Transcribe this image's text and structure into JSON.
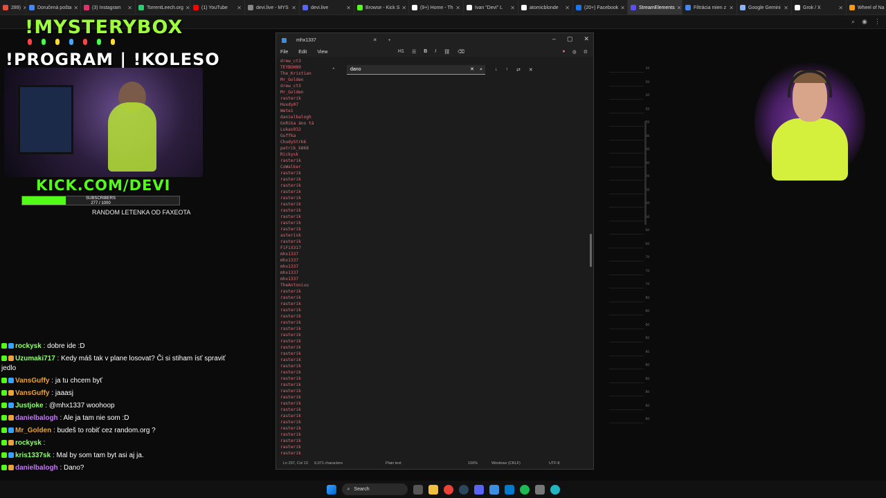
{
  "browser": {
    "tabs": [
      {
        "label": "289)",
        "color": "#e74c3c"
      },
      {
        "label": "Doručená pošta",
        "color": "#4285f4"
      },
      {
        "label": "(3) Instagram",
        "color": "#e1306c"
      },
      {
        "label": "TorrentLeech.org",
        "color": "#2ecc71"
      },
      {
        "label": "(1) YouTube",
        "color": "#ff0000"
      },
      {
        "label": "devi.live - MYS",
        "color": "#888888"
      },
      {
        "label": "devi.live",
        "color": "#5865f2"
      },
      {
        "label": "Browse - Kick S",
        "color": "#53fc18"
      },
      {
        "label": "(9+) Home - Th",
        "color": "#ffffff"
      },
      {
        "label": "Ivan \"Devi\" L",
        "color": "#ffffff"
      },
      {
        "label": "atomicblonde",
        "color": "#ffffff"
      },
      {
        "label": "(20+) Facebook",
        "color": "#1877f2"
      },
      {
        "label": "StreamElements",
        "color": "#5b4ef5"
      },
      {
        "label": "Filtrácia mien z",
        "color": "#4285f4"
      },
      {
        "label": "Google Gemini",
        "color": "#8ab4f8"
      },
      {
        "label": "Grok / X",
        "color": "#ffffff"
      },
      {
        "label": "Wheel of Na",
        "color": "#f39c12"
      }
    ],
    "active_tab_index": 12
  },
  "overlay": {
    "title1": "!MYSTERYBOX",
    "title2": "!PROGRAM | !KOLESO",
    "kick": "KICK.COM/DEVI",
    "subs_label": "SUBSCRIBERS",
    "subs_count": "277 / 1000",
    "subs_progress": 0.277,
    "random": "RANDOM LETENKA OD FAXEOTA"
  },
  "chat": [
    {
      "user": "rockysk",
      "color": "#8fff6f",
      "text": "dobre ide :D"
    },
    {
      "user": "Uzumaki717",
      "color": "#8fff6f",
      "text": "Kedy máš tak v plane losovat?  Či si stiham ísť spraviť jedlo"
    },
    {
      "user": "VansGuffy",
      "color": "#e8a33c",
      "text": "ja tu chcem byť"
    },
    {
      "user": "VansGuffy",
      "color": "#e8a33c",
      "text": "jaaasj"
    },
    {
      "user": "Justjoke",
      "color": "#8fff6f",
      "text": "@mhx1337 woohoop"
    },
    {
      "user": "danielbalogh",
      "color": "#c07cf0",
      "text": "Ale ja tam nie som :D"
    },
    {
      "user": "Mr_Golden",
      "color": "#e8a33c",
      "text": "budeš to robiť cez random.org ?"
    },
    {
      "user": "rockysk",
      "color": "#8fff6f",
      "text": ""
    },
    {
      "user": "kris1337sk",
      "color": "#8fff6f",
      "text": "Mal by som tam byt asi aj ja."
    },
    {
      "user": "danielbalogh",
      "color": "#c07cf0",
      "text": "Dano?"
    }
  ],
  "editor": {
    "tab_name": "mhx1337",
    "menu": [
      "File",
      "Edit",
      "View"
    ],
    "heading_btn": "H1",
    "find_query": "dano",
    "lines": [
      "drew_ct3",
      "TEYBOH89",
      "The_Kristian",
      "Mr_Golden",
      "drew_ct3",
      "Mr_Golden",
      "rasterik",
      "Huxdy07",
      "Wete1",
      "danielbalogh",
      "GoRika áno tá",
      "Lukas932",
      "Guffka",
      "ChudyStrk6",
      "patrik_k868",
      "Rickysk",
      "rasterik",
      "CoWalker",
      "rasterik",
      "rasterik",
      "rasterik",
      "rasterik",
      "rasterik",
      "rasterik",
      "rasterik",
      "rasterik",
      "rasterik",
      "rasterik",
      "asterisk",
      "rasterik",
      "FiFiX317",
      "mhx1337",
      "mhx1337",
      "mhx1337",
      "mhx1337",
      "mhx1337",
      "TheAntoniuu",
      "rasterik",
      "rasterik",
      "rasterik",
      "rasterik",
      "rasterik",
      "rasterik",
      "rasterik",
      "rasterik",
      "rasterik",
      "rasterik",
      "rasterik",
      "rasterik",
      "rasterik",
      "rasterik",
      "rasterik",
      "rasterik",
      "rasterik",
      "rasterik",
      "rasterik",
      "rasterik",
      "rasterik",
      "rasterik",
      "rasterik",
      "rasterik",
      "rasterik",
      "rasterik",
      "rasterik"
    ],
    "status": {
      "position": "Ln 297, Col 13",
      "chars": "6,071 characters",
      "mode": "Plain text",
      "zoom": "100%",
      "eol": "Windows (CRLF)",
      "encoding": "UTF-8"
    }
  },
  "right_panel_rows": [
    "1d",
    "2d",
    "2d",
    "2d",
    "2d",
    "3d",
    "3d",
    "4d",
    "2d",
    "2d",
    "3d",
    "6d",
    "6d",
    "6d",
    "7d",
    "7d",
    "7d",
    "8d",
    "8d",
    "8d",
    "8d",
    "8d",
    "8d",
    "8d",
    "8d",
    "8d",
    "8d"
  ],
  "taskbar": {
    "search_label": "Search"
  }
}
